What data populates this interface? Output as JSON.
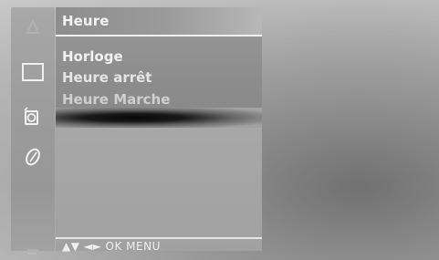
{
  "menu": {
    "title": "Heure",
    "items": [
      {
        "label": "Horloge"
      },
      {
        "label": "Heure arrêt"
      },
      {
        "label": "Heure Marche"
      }
    ]
  },
  "sidebar": {
    "icons": [
      "faded-top-icon",
      "tv-screen-icon",
      "alarm-clock-icon",
      "option-icon",
      "faded-bottom-icon"
    ]
  },
  "footer": {
    "nav_hint": "▲▼ ◄► OK MENU"
  },
  "colors": {
    "menu_text": "#f2f2f2",
    "panel_gray": "#a8a8a8",
    "title_bar_gray": "#8d8d8d"
  }
}
